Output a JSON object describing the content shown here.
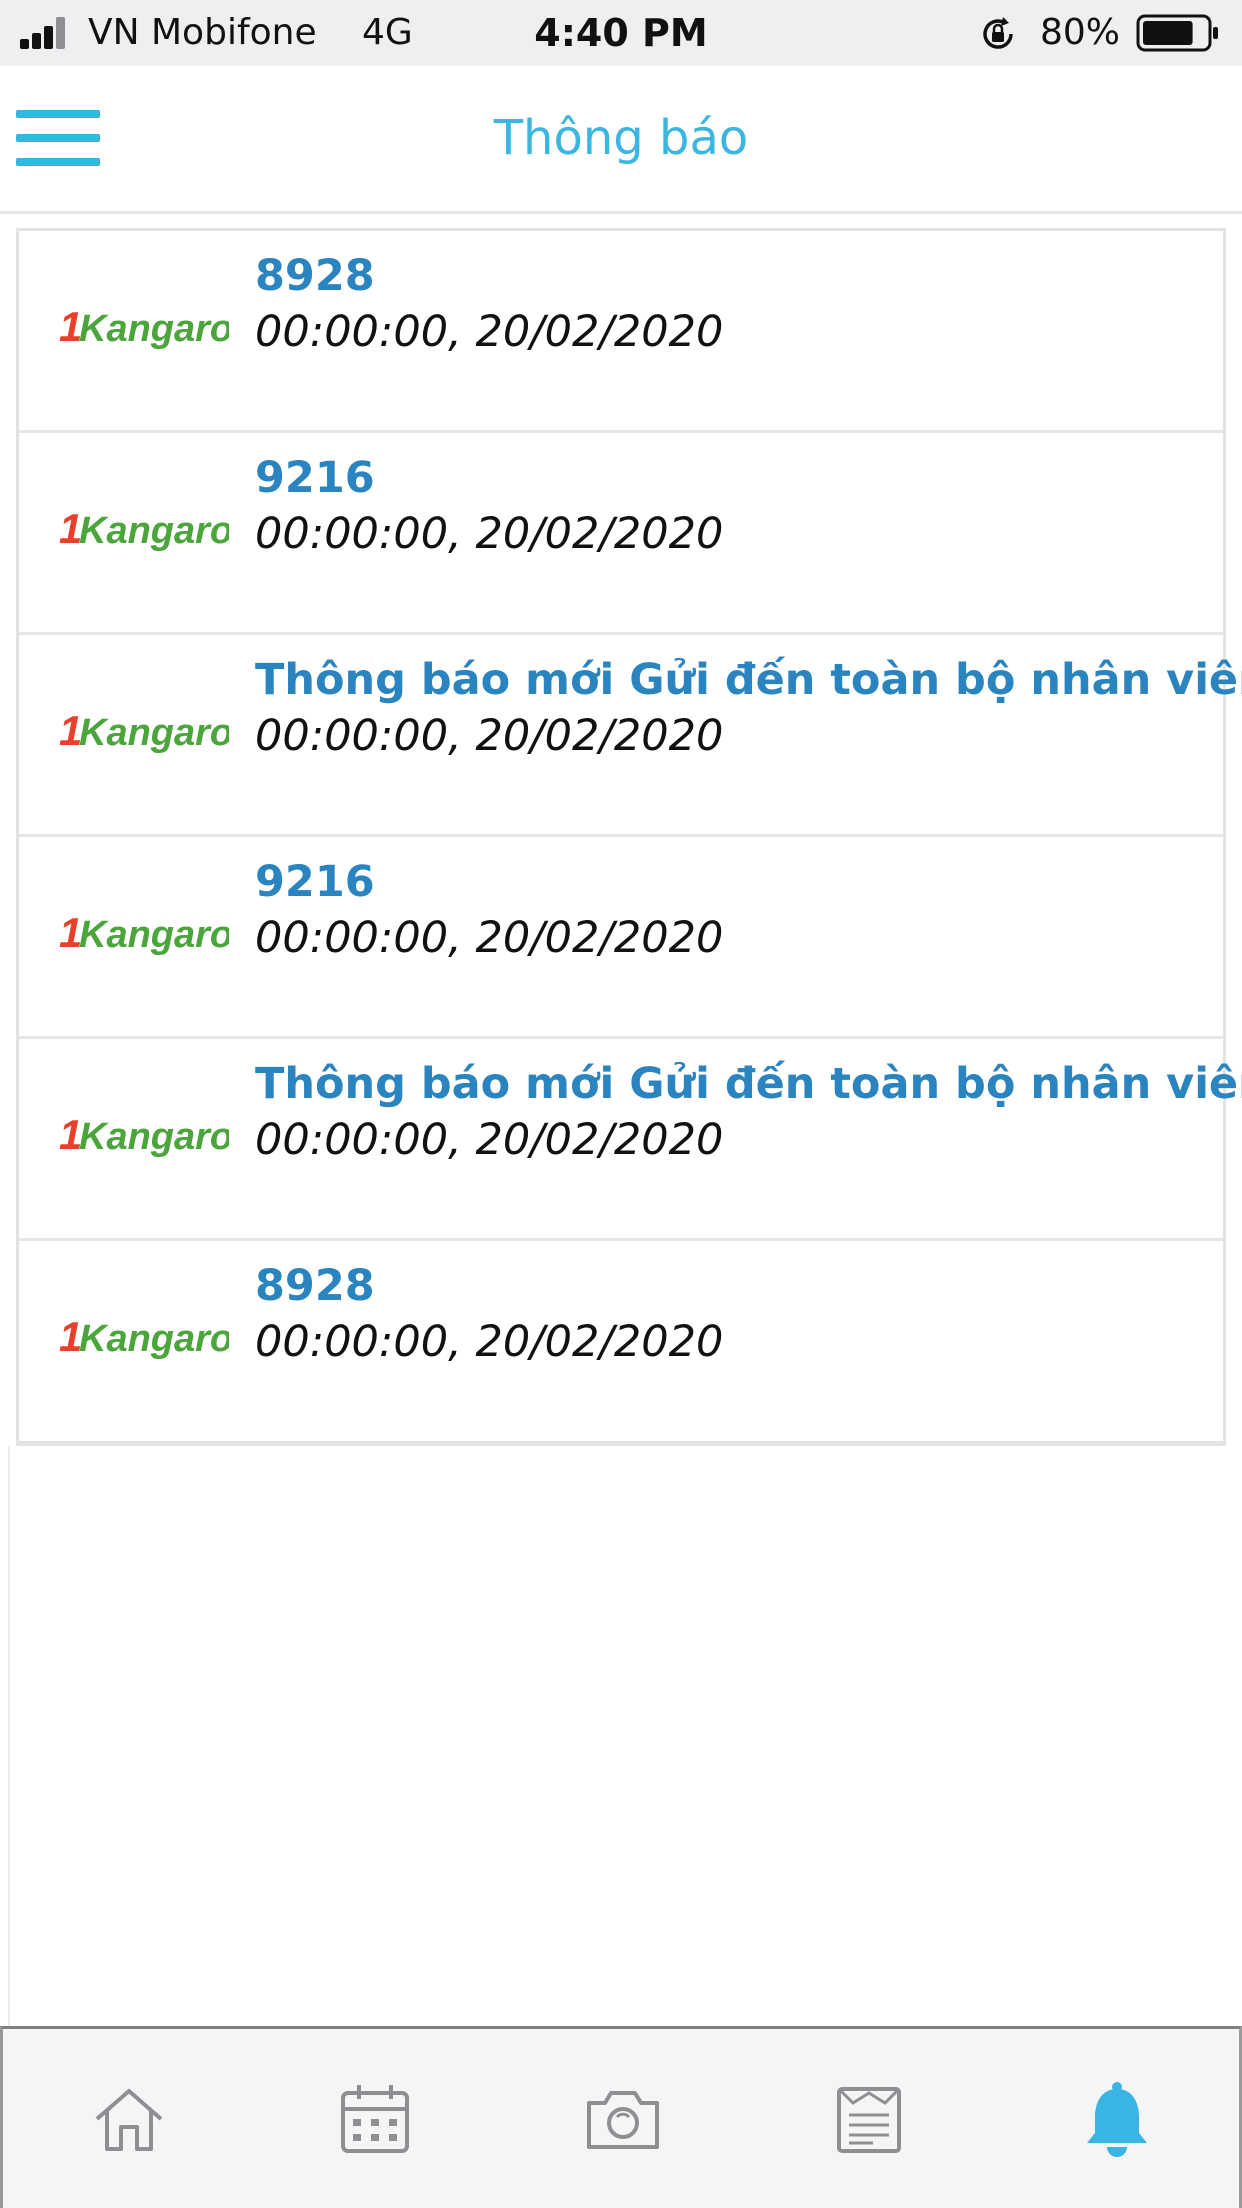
{
  "status_bar": {
    "carrier": "VN Mobifone",
    "network": "4G",
    "time": "4:40 PM",
    "battery": "80%",
    "battery_level": 0.8
  },
  "header": {
    "title": "Thông báo",
    "menu_icon": "hamburger-menu-icon"
  },
  "notifications": [
    {
      "title": "8928",
      "time": "00:00:00, 20/02/2020",
      "logo": "Kangaroo"
    },
    {
      "title": "9216",
      "time": "00:00:00, 20/02/2020",
      "logo": "Kangaroo"
    },
    {
      "title": "Thông báo mới Gửi đến toàn bộ nhân viên",
      "time": "00:00:00, 20/02/2020",
      "logo": "Kangaroo"
    },
    {
      "title": "9216",
      "time": "00:00:00, 20/02/2020",
      "logo": "Kangaroo"
    },
    {
      "title": "Thông báo mới Gửi đến toàn bộ nhân viên",
      "time": "00:00:00, 20/02/2020",
      "logo": "Kangaroo"
    },
    {
      "title": "8928",
      "time": "00:00:00, 20/02/2020",
      "logo": "Kangaroo"
    }
  ],
  "tab_bar": {
    "tabs": [
      {
        "icon": "home-icon",
        "active": false
      },
      {
        "icon": "calendar-icon",
        "active": false
      },
      {
        "icon": "camera-icon",
        "active": false
      },
      {
        "icon": "report-icon",
        "active": false
      },
      {
        "icon": "bell-icon",
        "active": true
      }
    ]
  },
  "colors": {
    "accent": "#34b8e2",
    "title_blue": "#2a84c0",
    "logo_red": "#e8402a",
    "logo_green": "#4aa53a",
    "tab_inactive": "#8e8e93",
    "tab_active": "#3ab4e2"
  }
}
